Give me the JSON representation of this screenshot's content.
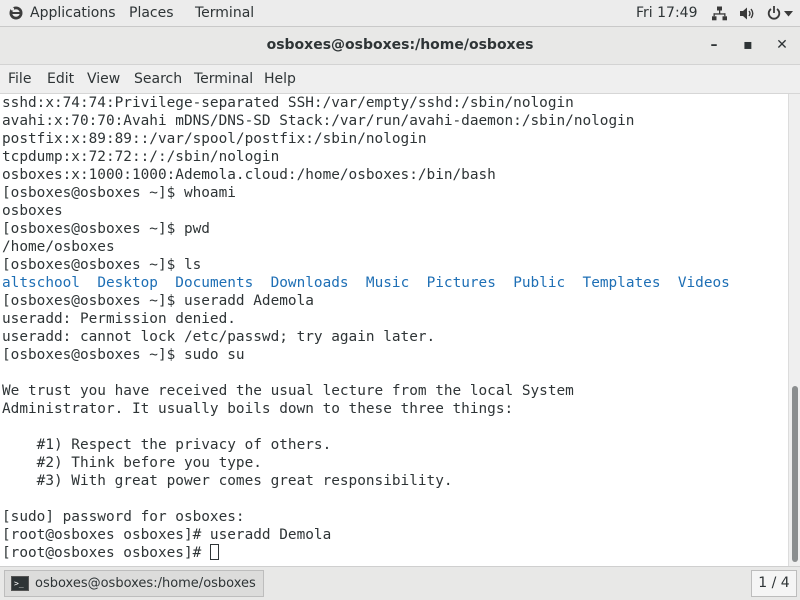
{
  "topbar": {
    "applications": "Applications",
    "places": "Places",
    "terminal": "Terminal",
    "clock": "Fri 17:49",
    "icons": [
      "network-icon",
      "volume-icon",
      "power-icon"
    ]
  },
  "window": {
    "title": "osboxes@osboxes:/home/osboxes",
    "minimize": "–",
    "maximize": "▪",
    "close": "✕"
  },
  "menubar": {
    "items": [
      "File",
      "Edit",
      "View",
      "Search",
      "Terminal",
      "Help"
    ]
  },
  "terminal": {
    "lines": [
      "sshd:x:74:74:Privilege-separated SSH:/var/empty/sshd:/sbin/nologin",
      "avahi:x:70:70:Avahi mDNS/DNS-SD Stack:/var/run/avahi-daemon:/sbin/nologin",
      "postfix:x:89:89::/var/spool/postfix:/sbin/nologin",
      "tcpdump:x:72:72::/:/sbin/nologin",
      "osboxes:x:1000:1000:Ademola.cloud:/home/osboxes:/bin/bash",
      "[osboxes@osboxes ~]$ whoami",
      "osboxes",
      "[osboxes@osboxes ~]$ pwd",
      "/home/osboxes",
      "[osboxes@osboxes ~]$ ls",
      "",
      "[osboxes@osboxes ~]$ useradd Ademola",
      "useradd: Permission denied.",
      "useradd: cannot lock /etc/passwd; try again later.",
      "[osboxes@osboxes ~]$ sudo su",
      "",
      "We trust you have received the usual lecture from the local System",
      "Administrator. It usually boils down to these three things:",
      "",
      "    #1) Respect the privacy of others.",
      "    #2) Think before you type.",
      "    #3) With great power comes great responsibility.",
      "",
      "[sudo] password for osboxes:",
      "[root@osboxes osboxes]# useradd Demola",
      "[root@osboxes osboxes]# "
    ],
    "ls_output": [
      "altschool",
      "Desktop",
      "Documents",
      "Downloads",
      "Music",
      "Pictures",
      "Public",
      "Templates",
      "Videos"
    ],
    "dir_color": "#1e6fb5",
    "text_color": "#2e3436"
  },
  "taskbar": {
    "task_label": "osboxes@osboxes:/home/osboxes",
    "workspace": "1 / 4"
  }
}
